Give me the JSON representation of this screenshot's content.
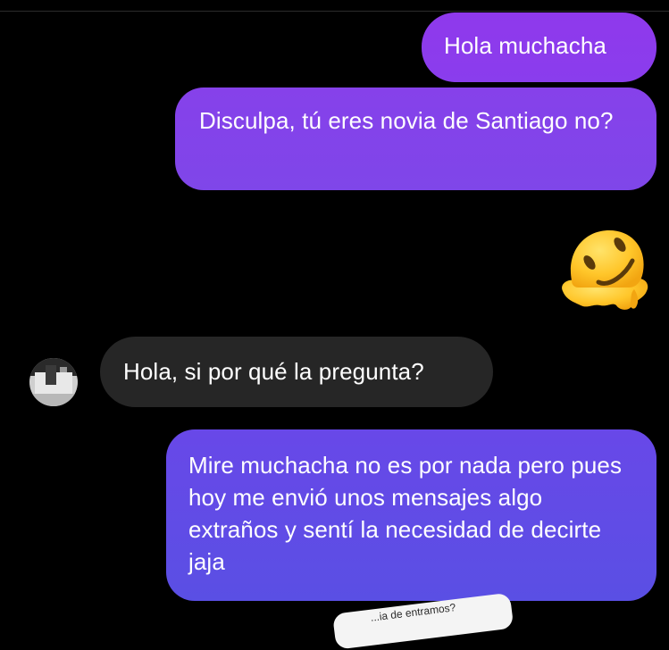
{
  "messages": {
    "sent_1": "Hola muchacha",
    "sent_2": "Disculpa, tú eres novia de Santiago no?",
    "received_1": "Hola, si por qué la pregunta?",
    "sent_3": "Mire muchacha no es por nada pero pues hoy me envió unos mensajes algo extraños y sentí la necesidad de decirte jaja"
  },
  "reaction_emoji": "melting-face-emoji",
  "shared_preview": {
    "text": "...ia de entramos?"
  },
  "colors": {
    "background": "#000000",
    "sent_bubble_top": "#8f39ec",
    "sent_bubble_bottom": "#5a4fe4",
    "received_bubble": "#262626",
    "text": "#ffffff"
  }
}
